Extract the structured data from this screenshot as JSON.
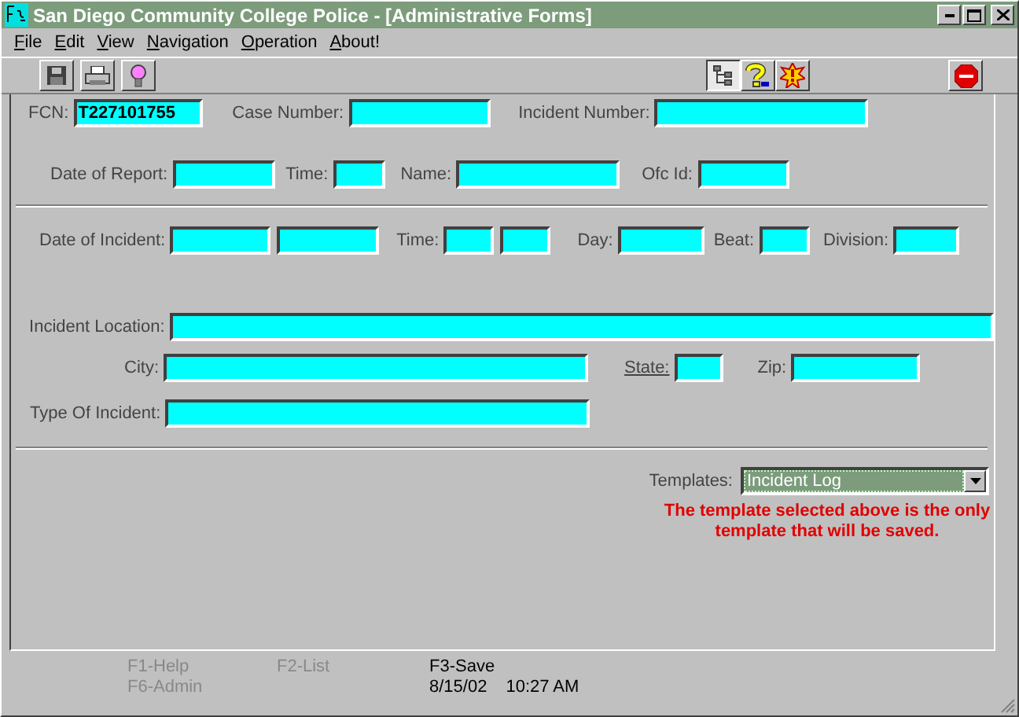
{
  "window": {
    "title": "San Diego Community College Police - [Administrative Forms]"
  },
  "menu": [
    {
      "label": "File"
    },
    {
      "label": "Edit"
    },
    {
      "label": "View"
    },
    {
      "label": "Navigation"
    },
    {
      "label": "Operation"
    },
    {
      "label": "About!"
    }
  ],
  "toolbar": {
    "left": [
      {
        "kind": "save",
        "pressed": false
      },
      {
        "kind": "print",
        "pressed": false
      },
      {
        "kind": "bulb",
        "pressed": false
      }
    ],
    "right": [
      {
        "kind": "tree",
        "pressed": true
      },
      {
        "kind": "question",
        "pressed": false
      },
      {
        "kind": "alert",
        "pressed": false
      }
    ],
    "end": [
      {
        "kind": "stop",
        "pressed": false
      }
    ]
  },
  "form": {
    "rows": [
      {
        "items": [
          {
            "label": "FCN:",
            "fields": [
              {
                "kind": "text",
                "value": "T227101755"
              }
            ]
          },
          {
            "label": "Case Number:",
            "fields": [
              {
                "kind": "text"
              }
            ]
          },
          {
            "label": "Incident Number:",
            "fields": [
              {
                "kind": "text"
              }
            ]
          }
        ]
      },
      {
        "items": [
          {
            "label": "Date of Report:",
            "fields": [
              {
                "kind": "text"
              }
            ]
          },
          {
            "label": "Time:",
            "fields": [
              {
                "kind": "text"
              }
            ]
          },
          {
            "label": "Name:",
            "fields": [
              {
                "kind": "text"
              }
            ]
          },
          {
            "label": "Ofc Id:",
            "fields": [
              {
                "kind": "text"
              }
            ]
          }
        ]
      },
      {
        "items": [
          {
            "label": "Date of Incident:",
            "fields": [
              {
                "kind": "text"
              },
              {
                "kind": "text"
              }
            ]
          },
          {
            "label": "Time:",
            "fields": [
              {
                "kind": "text"
              },
              {
                "kind": "text"
              }
            ]
          },
          {
            "label": "Day:",
            "fields": [
              {
                "kind": "text"
              }
            ]
          },
          {
            "label": "Beat:",
            "fields": [
              {
                "kind": "text"
              }
            ]
          },
          {
            "label": "Division:",
            "fields": [
              {
                "kind": "text"
              }
            ]
          }
        ]
      },
      {
        "items": [
          {
            "label": "Incident Location:",
            "fields": [
              {
                "kind": "text"
              }
            ]
          }
        ]
      },
      {
        "items": [
          {
            "label": "City:",
            "fields": [
              {
                "kind": "text"
              }
            ]
          },
          {
            "label": "State:",
            "underlined": true,
            "fields": [
              {
                "kind": "text"
              }
            ]
          },
          {
            "label": "Zip:",
            "fields": [
              {
                "kind": "text"
              }
            ]
          }
        ]
      },
      {
        "items": [
          {
            "label": "Type Of Incident:",
            "fields": [
              {
                "kind": "text"
              }
            ]
          }
        ]
      }
    ],
    "templates": {
      "label": "Templates:",
      "value": "Incident Log",
      "focused": true
    },
    "notice": "The template selected above is the only template that will be saved."
  },
  "status_bar": {
    "keys": [
      {
        "label": "F1-Help",
        "disabled": true
      },
      {
        "label": "F2-List",
        "disabled": true
      },
      {
        "label": "F3-Save",
        "disabled": false
      },
      {
        "label": "F6-Admin",
        "disabled": true
      }
    ],
    "date": "8/15/02",
    "time": "10:27 AM"
  }
}
